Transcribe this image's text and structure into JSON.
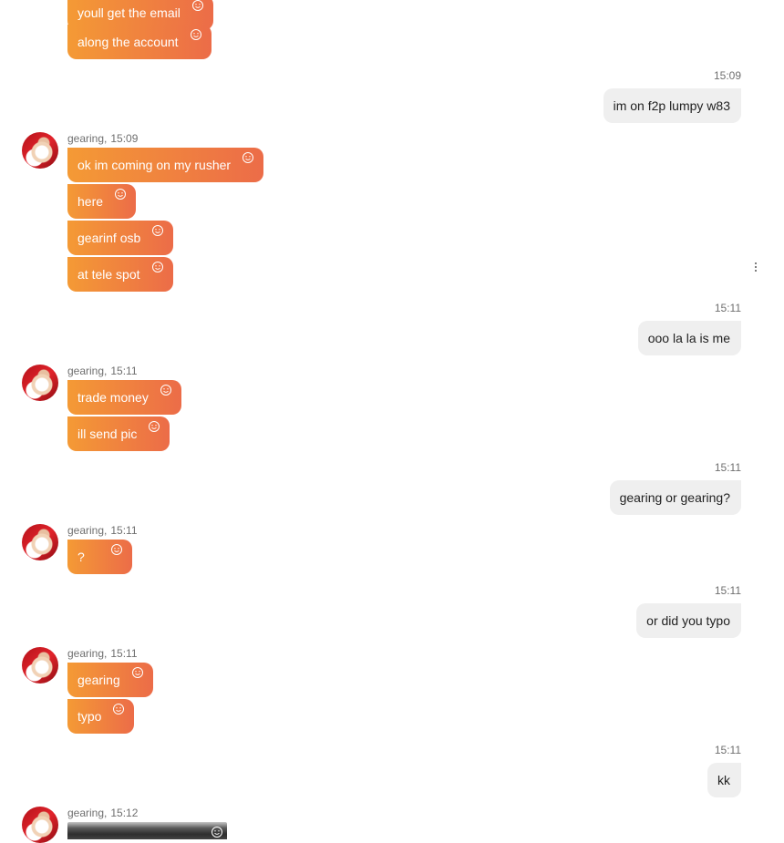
{
  "colors": {
    "incoming_bubble_start": "#f49a35",
    "incoming_bubble_end": "#ec6c48",
    "outgoing_bubble": "#efefef",
    "meta_text": "#6f6f6f"
  },
  "icons": {
    "reaction": "smiley-face-icon",
    "menu": "vertical-ellipsis-icon",
    "avatar": "santa-profile-avatar"
  },
  "messages": {
    "g1": {
      "m1": "youll get the email",
      "m2": "along the account"
    },
    "o1": {
      "time": "15:09",
      "text": "im on f2p lumpy w83"
    },
    "g2": {
      "sender": "gearing",
      "time": "15:09",
      "m1": "ok im coming on my rusher",
      "m2": "here",
      "m3": "gearinf osb",
      "m4": "at tele spot"
    },
    "o2": {
      "time": "15:11",
      "text": "ooo la la is me"
    },
    "g3": {
      "sender": "gearing",
      "time": "15:11",
      "m1": "trade money",
      "m2": "ill send pic"
    },
    "o3": {
      "time": "15:11",
      "text": "gearing or gearing?"
    },
    "g4": {
      "sender": "gearing",
      "time": "15:11",
      "m1": "?"
    },
    "o4": {
      "time": "15:11",
      "text": "or did you typo"
    },
    "g5": {
      "sender": "gearing",
      "time": "15:11",
      "m1": "gearing",
      "m2": "typo"
    },
    "o5": {
      "time": "15:11",
      "text": "kk"
    },
    "g6": {
      "sender": "gearing",
      "time": "15:12"
    }
  }
}
